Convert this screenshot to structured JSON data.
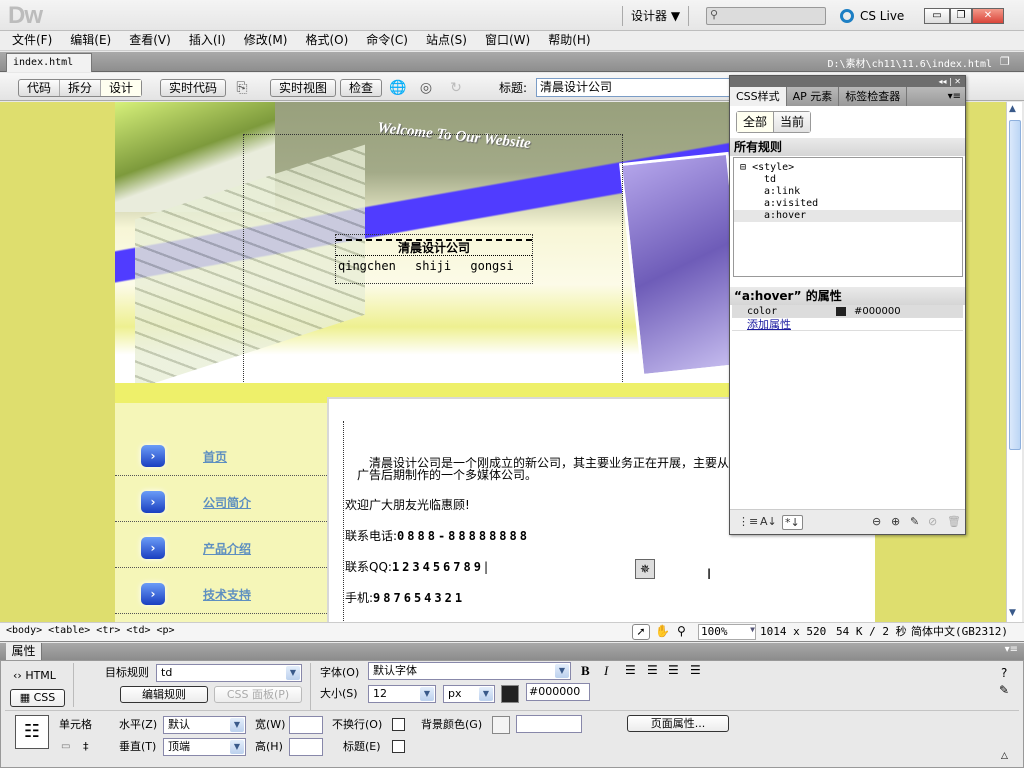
{
  "app": {
    "logo": "Dw",
    "workspace": "设计器 ▼",
    "search_placeholder": "",
    "cs_live": "CS Live",
    "window_buttons": {
      "minimize": "▭",
      "restore": "❐",
      "close": "✕"
    }
  },
  "menu": [
    "文件(F)",
    "编辑(E)",
    "查看(V)",
    "插入(I)",
    "修改(M)",
    "格式(O)",
    "命令(C)",
    "站点(S)",
    "窗口(W)",
    "帮助(H)"
  ],
  "document": {
    "tab": "index.html",
    "tab_close": "×",
    "path": "D:\\素材\\ch11\\11.6\\index.html"
  },
  "toolbar": {
    "views": [
      "代码",
      "拆分",
      "设计"
    ],
    "active_view": "设计",
    "live_code": "实时代码",
    "live_view": "实时视图",
    "inspect": "检查",
    "title_label": "标题:",
    "title_value": "清晨设计公司"
  },
  "page": {
    "welcome": "Welcome To Our Website",
    "company_name": "清晨设计公司",
    "company_pinyin": "qingchen shiji gongsi",
    "nav": [
      "首页",
      "公司简介",
      "产品介绍",
      "技术支持"
    ],
    "nav_icon": "arrow-right-button",
    "intro_line1": "清晨设计公司是一个刚成立的新公司，其主要业务正在开展，主要从",
    "intro_line2": "广告后期制作的一个多媒体公司。",
    "welcome_msg": "欢迎广大朋友光临惠顾!",
    "phone_label": "联系电话:",
    "phone": "0888-88888888",
    "qq_label": "联系QQ:",
    "qq": "123456789",
    "mobile_label": "手机:",
    "mobile": "987654321"
  },
  "statusbar": {
    "tags": "<body> <table> <tr> <td> <p>",
    "zoom": "100%",
    "size": "1014 x 520",
    "download": "54 K / 2 秒",
    "encoding": "简体中文(GB2312)"
  },
  "properties": {
    "tab": "属性",
    "html_btn": "HTML",
    "css_btn": "CSS",
    "target_rule_label": "目标规则",
    "target_rule": "td",
    "edit_rule": "编辑规则",
    "css_panel": "CSS 面板(P)",
    "font_label": "字体(O)",
    "font": "默认字体",
    "size_label": "大小(S)",
    "size": "12",
    "size_unit": "px",
    "color": "#000000",
    "cell_label": "单元格",
    "horz_label": "水平(Z)",
    "horz": "默认",
    "vert_label": "垂直(T)",
    "vert": "顶端",
    "width_label": "宽(W)",
    "height_label": "高(H)",
    "nowrap_label": "不换行(O)",
    "header_label": "标题(E)",
    "bg_label": "背景颜色(G)",
    "page_props": "页面属性...",
    "bold": "B",
    "italic": "I"
  },
  "css_panel": {
    "tabs": [
      "CSS样式",
      "AP 元素",
      "标签检查器"
    ],
    "filters": [
      "全部",
      "当前"
    ],
    "active_filter": "全部",
    "all_rules_title": "所有规则",
    "rules": [
      "<style>",
      "td",
      "a:link",
      "a:visited",
      "a:hover"
    ],
    "selected_rule": "a:hover",
    "props_title": "“a:hover” 的属性",
    "props": [
      {
        "name": "color",
        "value": "#000000"
      }
    ],
    "add_property": "添加属性"
  },
  "colors": {
    "design_bg": "#dede6e",
    "nav_bg": "#f5f6b8",
    "link": "#5e8fc0",
    "banner_blue": "#5040ff"
  }
}
